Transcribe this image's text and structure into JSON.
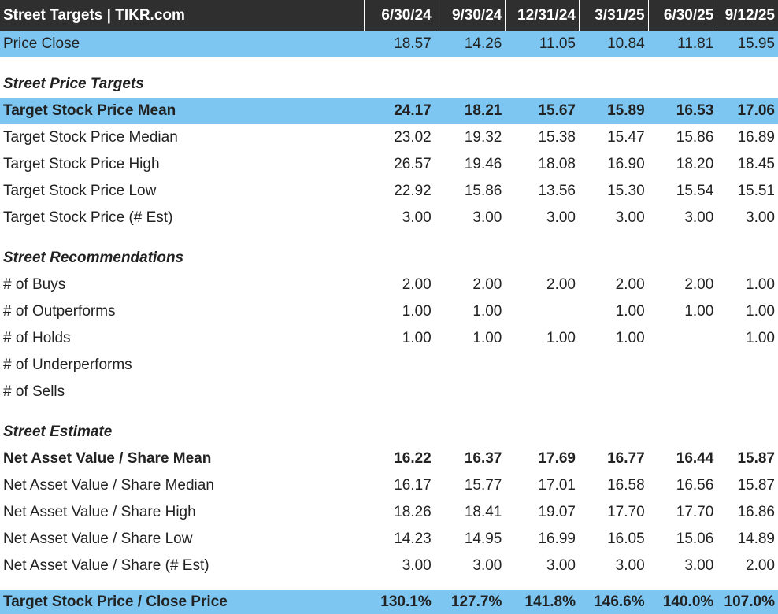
{
  "header": {
    "title": "Street Targets | TIKR.com",
    "columns": [
      "6/30/24",
      "9/30/24",
      "12/31/24",
      "3/31/25",
      "6/30/25",
      "9/12/25"
    ]
  },
  "price_close": {
    "label": "Price Close",
    "values": [
      "18.57",
      "14.26",
      "11.05",
      "10.84",
      "11.81",
      "15.95"
    ]
  },
  "sections": {
    "price_targets": "Street Price Targets",
    "recommendations": "Street Recommendations",
    "estimate": "Street Estimate"
  },
  "price_target_rows": [
    {
      "label": "Target Stock Price Mean",
      "values": [
        "24.17",
        "18.21",
        "15.67",
        "15.89",
        "16.53",
        "17.06"
      ]
    },
    {
      "label": "Target Stock Price Median",
      "values": [
        "23.02",
        "19.32",
        "15.38",
        "15.47",
        "15.86",
        "16.89"
      ]
    },
    {
      "label": "Target Stock Price High",
      "values": [
        "26.57",
        "19.46",
        "18.08",
        "16.90",
        "18.20",
        "18.45"
      ]
    },
    {
      "label": "Target Stock Price Low",
      "values": [
        "22.92",
        "15.86",
        "13.56",
        "15.30",
        "15.54",
        "15.51"
      ]
    },
    {
      "label": "Target Stock Price (# Est)",
      "values": [
        "3.00",
        "3.00",
        "3.00",
        "3.00",
        "3.00",
        "3.00"
      ]
    }
  ],
  "recommendation_rows": [
    {
      "label": "# of Buys",
      "values": [
        "2.00",
        "2.00",
        "2.00",
        "2.00",
        "2.00",
        "1.00"
      ]
    },
    {
      "label": "# of Outperforms",
      "values": [
        "1.00",
        "1.00",
        "",
        "1.00",
        "1.00",
        "1.00"
      ]
    },
    {
      "label": "# of Holds",
      "values": [
        "1.00",
        "1.00",
        "1.00",
        "1.00",
        "",
        "1.00"
      ]
    },
    {
      "label": "# of Underperforms",
      "values": [
        "",
        "",
        "",
        "",
        "",
        ""
      ]
    },
    {
      "label": "# of Sells",
      "values": [
        "",
        "",
        "",
        "",
        "",
        ""
      ]
    }
  ],
  "estimate_rows": [
    {
      "label": "Net Asset Value / Share Mean",
      "values": [
        "16.22",
        "16.37",
        "17.69",
        "16.77",
        "16.44",
        "15.87"
      ]
    },
    {
      "label": "Net Asset Value / Share Median",
      "values": [
        "16.17",
        "15.77",
        "17.01",
        "16.58",
        "16.56",
        "15.87"
      ]
    },
    {
      "label": "Net Asset Value / Share High",
      "values": [
        "18.26",
        "18.41",
        "19.07",
        "17.70",
        "17.70",
        "16.86"
      ]
    },
    {
      "label": "Net Asset Value / Share Low",
      "values": [
        "14.23",
        "14.95",
        "16.99",
        "16.05",
        "15.06",
        "14.89"
      ]
    },
    {
      "label": "Net Asset Value / Share (# Est)",
      "values": [
        "3.00",
        "3.00",
        "3.00",
        "3.00",
        "3.00",
        "2.00"
      ]
    }
  ],
  "ratio_row": {
    "label": "Target Stock Price / Close Price",
    "values": [
      "130.1%",
      "127.7%",
      "141.8%",
      "146.6%",
      "140.0%",
      "107.0%"
    ]
  },
  "colors": {
    "header_bg": "#2f2f2f",
    "highlight_blue": "#7cc6f1"
  }
}
